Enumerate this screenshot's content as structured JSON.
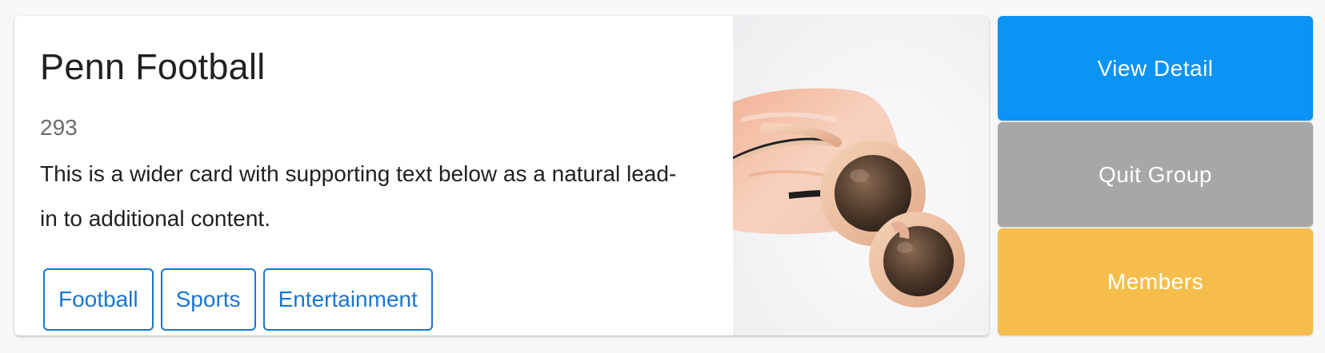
{
  "card": {
    "title": "Penn Football",
    "count": "293",
    "description": "This is a wider card with supporting text below as a natural lead-in to additional content.",
    "tags": [
      "Football",
      "Sports",
      "Entertainment"
    ],
    "image_subject": "sunglasses-on-pink-rock",
    "tag_color": "#1976d2"
  },
  "actions": {
    "view_detail": "View Detail",
    "quit_group": "Quit Group",
    "members": "Members"
  },
  "colors": {
    "view_detail": "#0b93f6",
    "quit_group": "#a7a7a7",
    "members": "#f5be4c"
  }
}
